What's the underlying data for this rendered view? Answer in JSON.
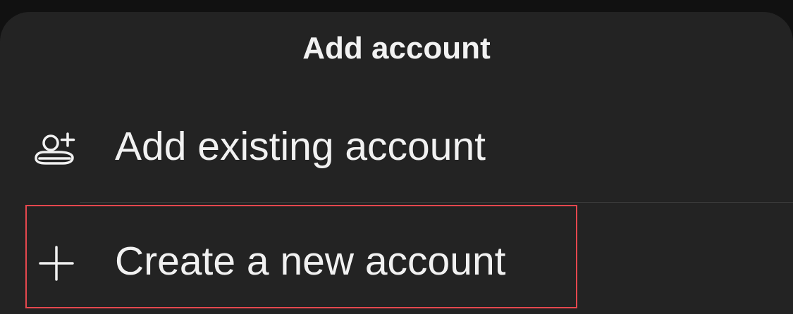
{
  "sheet": {
    "title": "Add account"
  },
  "menu": {
    "items": [
      {
        "label": "Add existing account",
        "icon": "add-person-icon"
      },
      {
        "label": "Create a new account",
        "icon": "plus-icon"
      }
    ]
  },
  "colors": {
    "page_background": "#111111",
    "sheet_background": "#232323",
    "text": "#f1f1f1",
    "divider": "#3a3a3a",
    "highlight_outline": "#e5474e"
  }
}
